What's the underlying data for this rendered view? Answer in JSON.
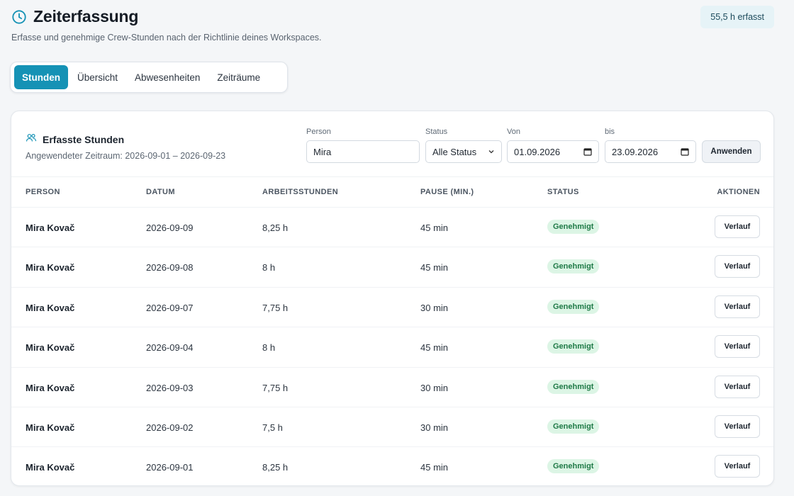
{
  "header": {
    "title": "Zeiterfassung",
    "subtitle": "Erfasse und genehmige Crew-Stunden nach der Richtlinie deines Workspaces.",
    "total_badge": "55,5 h erfasst",
    "title_icon": "clock-icon",
    "accent_color": "#1592b5"
  },
  "tabs": [
    {
      "label": "Stunden",
      "active": true
    },
    {
      "label": "Übersicht",
      "active": false
    },
    {
      "label": "Abwesenheiten",
      "active": false
    },
    {
      "label": "Zeiträume",
      "active": false
    }
  ],
  "section": {
    "title": "Erfasste Stunden",
    "icon": "users-icon",
    "range_text": "Angewendeter Zeitraum: 2026-09-01 – 2026-09-23"
  },
  "filters": {
    "person_label": "Person",
    "person_value": "Mira",
    "status_label": "Status",
    "status_value": "Alle Status",
    "from_label": "Von",
    "from_value": "01.09.2026",
    "to_label": "bis",
    "to_value": "23.09.2026",
    "apply_label": "Anwenden"
  },
  "table": {
    "columns": [
      "Person",
      "Datum",
      "Arbeitsstunden",
      "Pause (min.)",
      "Status",
      "Aktionen"
    ],
    "rows": [
      {
        "person": "Mira Kovač",
        "date": "2026-09-09",
        "hours": "8,25 h",
        "pause": "45 min",
        "status": "Genehmigt",
        "action": "Verlauf"
      },
      {
        "person": "Mira Kovač",
        "date": "2026-09-08",
        "hours": "8 h",
        "pause": "45 min",
        "status": "Genehmigt",
        "action": "Verlauf"
      },
      {
        "person": "Mira Kovač",
        "date": "2026-09-07",
        "hours": "7,75 h",
        "pause": "30 min",
        "status": "Genehmigt",
        "action": "Verlauf"
      },
      {
        "person": "Mira Kovač",
        "date": "2026-09-04",
        "hours": "8 h",
        "pause": "45 min",
        "status": "Genehmigt",
        "action": "Verlauf"
      },
      {
        "person": "Mira Kovač",
        "date": "2026-09-03",
        "hours": "7,75 h",
        "pause": "30 min",
        "status": "Genehmigt",
        "action": "Verlauf"
      },
      {
        "person": "Mira Kovač",
        "date": "2026-09-02",
        "hours": "7,5 h",
        "pause": "30 min",
        "status": "Genehmigt",
        "action": "Verlauf"
      },
      {
        "person": "Mira Kovač",
        "date": "2026-09-01",
        "hours": "8,25 h",
        "pause": "45 min",
        "status": "Genehmigt",
        "action": "Verlauf"
      }
    ]
  }
}
